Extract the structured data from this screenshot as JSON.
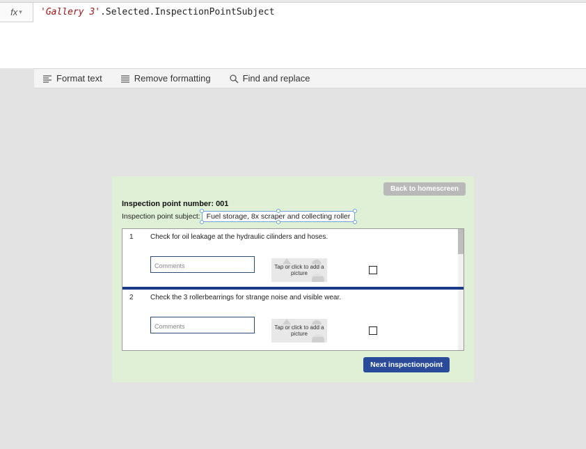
{
  "formula_bar": {
    "fx_label": "fx",
    "formula_string_part": "'Gallery 3'",
    "formula_rest": ".Selected.InspectionPointSubject"
  },
  "toolbar": {
    "format_text": "Format text",
    "remove_formatting": "Remove formatting",
    "find_replace": "Find and replace"
  },
  "app": {
    "back_button": "Back to homescreen",
    "ipn_label": "Inspection point number:",
    "ipn_value": "001",
    "subject_label": "Inspection point subject:",
    "subject_value": "Fuel storage, 8x scraper and collecting roller",
    "rows": [
      {
        "num": "1",
        "text": "Check for oil leakage at the hydraulic cilinders and hoses.",
        "comments_ph": "Comments",
        "picture_hint": "Tap or click to add a picture"
      },
      {
        "num": "2",
        "text": "Check the 3 rollerbearrings for strange noise and visible wear.",
        "comments_ph": "Comments",
        "picture_hint": "Tap or click to add a picture"
      }
    ],
    "next_button": "Next inspectionpoint"
  }
}
